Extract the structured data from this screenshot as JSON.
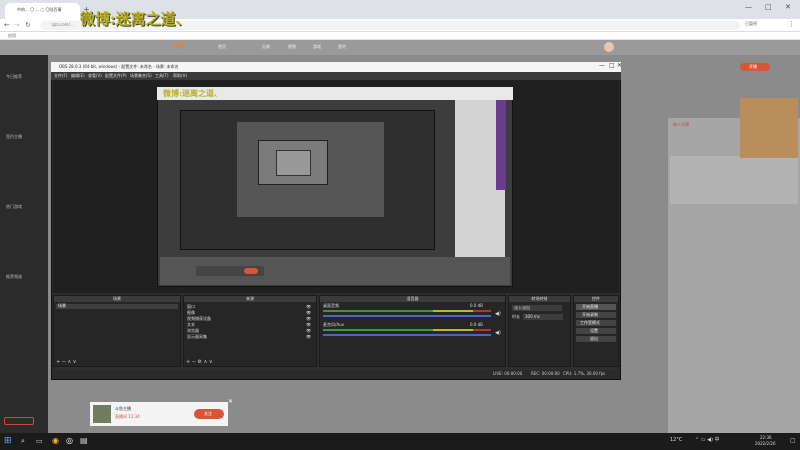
{
  "browser": {
    "tab_title": "中的... 〇 ... ▢ 〇陆百事",
    "url": "qzs.com/... ",
    "bookmark_label": "应用",
    "profile_status": "已暂停"
  },
  "watermark": "微博:迷离之道、",
  "site": {
    "brand": "〇陆 ",
    "nav": [
      "首页",
      "分类",
      "视频",
      "游戏",
      "签约"
    ],
    "left_sections": [
      "今日推荐",
      "签约主播",
      "热门游戏",
      "推荐频道"
    ],
    "open_live_button": "开播",
    "right_notice": "新人开播"
  },
  "obs": {
    "title": "OBS 28.0.3 (64-bit, windows) - 配置文件: 未命名 - 场景: 未命名",
    "menu": [
      "文件(F)",
      "编辑(E)",
      "查看(V)",
      "配置文件(P)",
      "场景集合(S)",
      "工具(T)",
      "帮助(H)"
    ],
    "docks": {
      "scenes": "场景",
      "sources": "来源",
      "mixer": "混音器",
      "transitions": "转场特效",
      "controls": "控件"
    },
    "scene_items": [
      "场景"
    ],
    "source_items": [
      "窗口",
      "图像",
      "视频捕获设备",
      "文本",
      "浏览器",
      "显示器采集"
    ],
    "mixer_tracks": [
      {
        "name": "桌面音频",
        "db": "0.0 dB"
      },
      {
        "name": "麦克风/Aux",
        "db": "0.0 dB"
      }
    ],
    "transition": {
      "type": "淡入淡出",
      "duration_label": "时长",
      "duration": "300 ms"
    },
    "controls": [
      "开始直播",
      "开始录制",
      "工作室模式",
      "设置",
      "退出"
    ],
    "status": {
      "live": "LIVE: 00:00:00",
      "rec": "REC: 00:00:00",
      "cpu": "CPU: 1.7%, 30.00 fps"
    }
  },
  "bottom_card": {
    "name": "斗鱼主播",
    "subtitle": "直播间 12:34",
    "button": "关注"
  },
  "taskbar": {
    "weather": "12°C",
    "time": "22:36",
    "date": "2022/2/26"
  }
}
